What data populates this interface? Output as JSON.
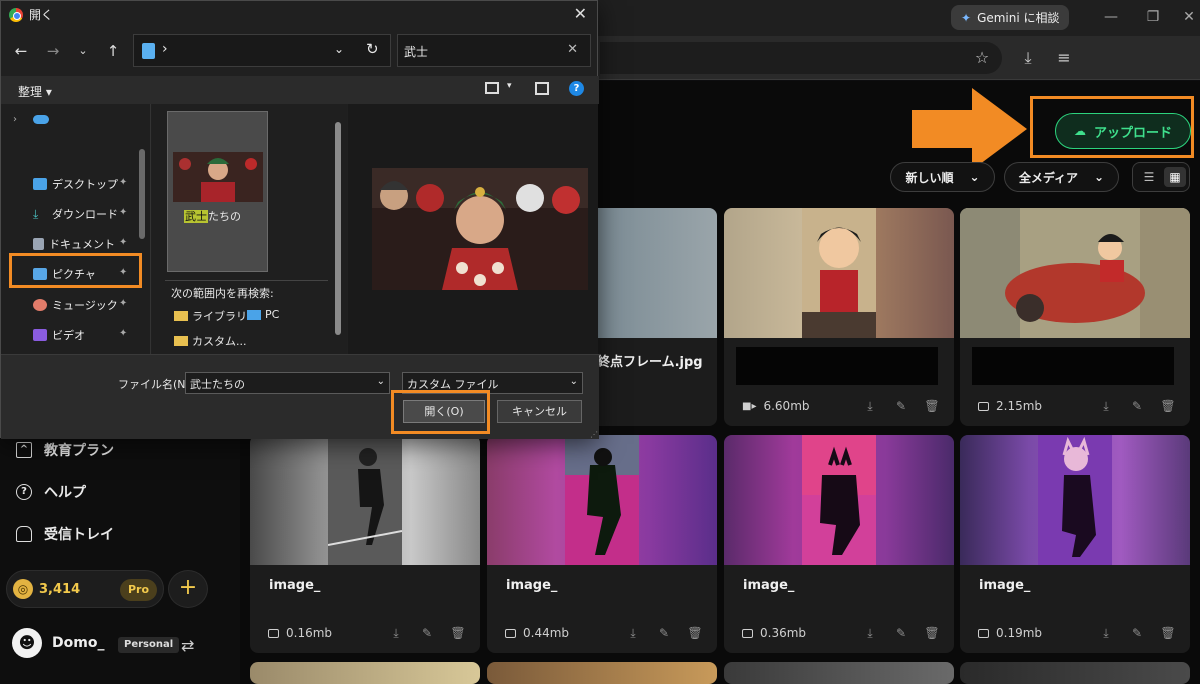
{
  "browser": {
    "gemini_label": "Gemini に相談"
  },
  "sidebar": {
    "items": [
      {
        "label": "教育プラン",
        "icon": "graduation-cap-icon"
      },
      {
        "label": "ヘルプ",
        "icon": "help-circle-icon"
      },
      {
        "label": "受信トレイ",
        "icon": "bell-icon"
      }
    ],
    "credits": "3,414",
    "pro_label": "Pro",
    "user_name": "Domo_",
    "plan_label": "Personal"
  },
  "toolbar": {
    "upload_label": "アップロード",
    "sort_label": "新しい順",
    "filter_label": "全メディア"
  },
  "cards": [
    {
      "title": "終点フレーム.jpg",
      "size": "",
      "kind": "image"
    },
    {
      "title": "",
      "size": "6.60mb",
      "kind": "video"
    },
    {
      "title": "",
      "size": "2.15mb",
      "kind": "image"
    },
    {
      "title": "image_",
      "size": "0.16mb",
      "kind": "image"
    },
    {
      "title": "image_",
      "size": "0.44mb",
      "kind": "image"
    },
    {
      "title": "image_",
      "size": "0.36mb",
      "kind": "image"
    },
    {
      "title": "image_",
      "size": "0.19mb",
      "kind": "image"
    }
  ],
  "dialog": {
    "title": "開く",
    "address_sep": "›",
    "search_value": "武士",
    "organize_label": "整理 ▾",
    "nav_items": [
      {
        "label": "デスクトップ",
        "color": "#4aa3e8"
      },
      {
        "label": "ダウンロード",
        "color": "#4ac0c0"
      },
      {
        "label": "ドキュメント",
        "color": "#9aa5b4"
      },
      {
        "label": "ピクチャ",
        "color": "#58a6e6"
      },
      {
        "label": "ミュージック",
        "color": "#e27c6a"
      },
      {
        "label": "ビデオ",
        "color": "#8a5ce0"
      }
    ],
    "file": {
      "highlight": "武士",
      "rest": "たちの"
    },
    "rescan_label": "次の範囲内を再検索:",
    "rescan_items": [
      "ライブラリ",
      "PC",
      "カスタム..."
    ],
    "filename_label": "ファイル名(N):",
    "filename_value": "武士たちの",
    "filetype_value": "カスタム ファイル",
    "open_label": "開く(O)",
    "cancel_label": "キャンセル"
  }
}
